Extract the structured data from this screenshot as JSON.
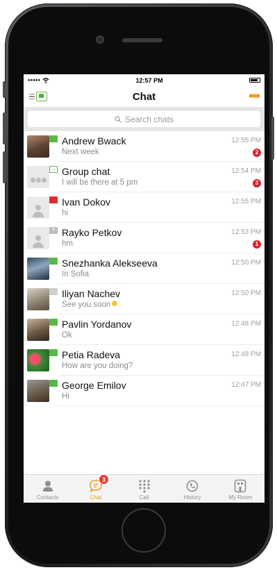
{
  "status_bar": {
    "signal": "●●●●●",
    "wifi": "wifi",
    "time": "12:57 PM",
    "battery": "battery"
  },
  "nav": {
    "title": "Chat",
    "more": "•••"
  },
  "search": {
    "placeholder": "Search chats"
  },
  "chats": [
    {
      "name": "Andrew Bwack",
      "message": "Next week",
      "time": "12:55 PM",
      "unread": "2",
      "status": "green",
      "avatar": "photo"
    },
    {
      "name": "Group chat",
      "message": "I will be there at 5 pm",
      "time": "12:54 PM",
      "unread": "3",
      "status": "arrow",
      "avatar": "group"
    },
    {
      "name": "Ivan Dokov",
      "message": "hi",
      "time": "12:55 PM",
      "unread": "",
      "status": "red",
      "avatar": "default"
    },
    {
      "name": "Rayko Petkov",
      "message": "hm",
      "time": "12:53 PM",
      "unread": "1",
      "status": "unknown",
      "avatar": "default"
    },
    {
      "name": "Snezhanka Alekseeva",
      "message": "In Sofia",
      "time": "12:50 PM",
      "unread": "",
      "status": "green",
      "avatar": "photo"
    },
    {
      "name": "Iliyan Nachev",
      "message": "See you soon",
      "time": "12:50 PM",
      "unread": "",
      "status": "gray",
      "avatar": "photo"
    },
    {
      "name": "Pavlin Yordanov",
      "message": "Ok",
      "time": "12:48 PM",
      "unread": "",
      "status": "green",
      "avatar": "photo"
    },
    {
      "name": "Petia Radeva",
      "message": "How are you doing?",
      "time": "12:48 PM",
      "unread": "",
      "status": "green",
      "avatar": "photo"
    },
    {
      "name": "George Emilov",
      "message": "Hi",
      "time": "12:47 PM",
      "unread": "",
      "status": "green",
      "avatar": "photo"
    }
  ],
  "tabs": [
    {
      "label": "Contacts",
      "icon": "contacts-icon"
    },
    {
      "label": "Chat",
      "icon": "chat-icon",
      "badge": "3"
    },
    {
      "label": "Call",
      "icon": "dialpad-icon"
    },
    {
      "label": "History",
      "icon": "history-icon"
    },
    {
      "label": "My Room",
      "icon": "room-icon"
    }
  ],
  "colors": {
    "accent": "#f39c1f",
    "online": "#58b947",
    "busy": "#e02c2c",
    "badge": "#d9232d"
  }
}
